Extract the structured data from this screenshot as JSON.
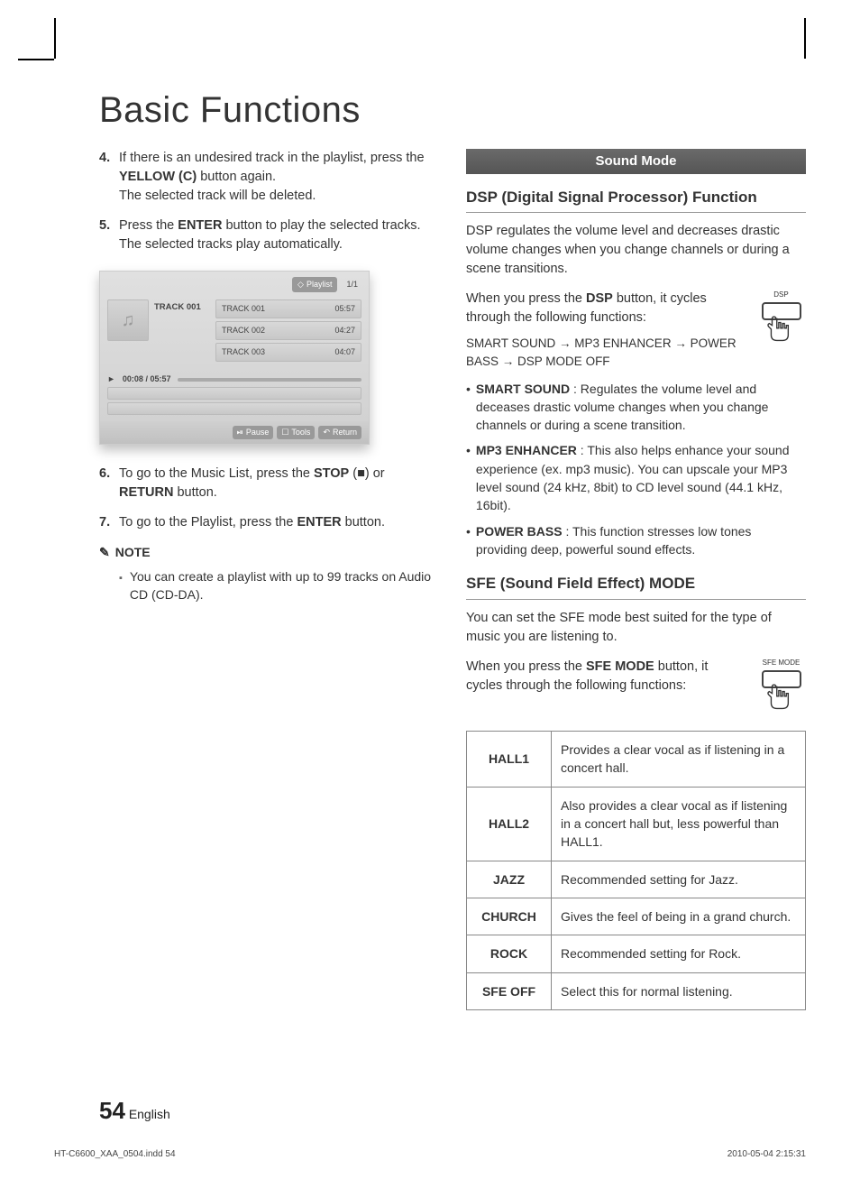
{
  "title": "Basic Functions",
  "left": {
    "steps": {
      "s4_num": "4.",
      "s4_a": "If there is an undesired track in the playlist, press the ",
      "s4_b": "YELLOW (C)",
      "s4_c": " button again.",
      "s4_d": "The selected track will be deleted.",
      "s5_num": "5.",
      "s5_a": "Press the ",
      "s5_b": "ENTER",
      "s5_c": " button to play the selected tracks.",
      "s5_d": "The selected tracks play automatically.",
      "s6_num": "6.",
      "s6_a": "To go to the Music List, press the ",
      "s6_b": "STOP",
      "s6_c": " (■) or ",
      "s6_d": "RETURN",
      "s6_e": " button.",
      "s7_num": "7.",
      "s7_a": "To go to the Playlist, press the ",
      "s7_b": "ENTER",
      "s7_c": " button."
    },
    "mock": {
      "playlist_label": "Playlist",
      "page": "1/1",
      "current": "TRACK 001",
      "rows": [
        {
          "name": "TRACK 001",
          "time": "05:57"
        },
        {
          "name": "TRACK 002",
          "time": "04:27"
        },
        {
          "name": "TRACK 003",
          "time": "04:07"
        }
      ],
      "progress": "00:08 / 05:57",
      "play_glyph": "►",
      "bottom": {
        "pause": "Pause",
        "tools": "Tools",
        "ret": "Return"
      }
    },
    "note_label": "NOTE",
    "note_text": "You can create a playlist with up to 99 tracks on Audio CD (CD-DA)."
  },
  "right": {
    "banner": "Sound Mode",
    "dsp_title": "DSP (Digital Signal Processor) Function",
    "dsp_para": "DSP regulates the volume level and decreases drastic volume changes when you change channels or during a scene transitions.",
    "dsp_press_a": "When you press the ",
    "dsp_press_b": "DSP",
    "dsp_press_c": " button, it cycles through the following functions:",
    "dsp_btn_label": "DSP",
    "chain": {
      "a": "SMART SOUND",
      "b": "MP3 ENHANCER",
      "c": "POWER BASS",
      "d": "DSP MODE OFF"
    },
    "bullets": {
      "b1_k": "SMART SOUND",
      "b1_v": " : Regulates the volume level and deceases drastic volume changes when you change channels or during a scene transition.",
      "b2_k": "MP3 ENHANCER",
      "b2_v": " : This also helps enhance your sound experience (ex. mp3 music). You can upscale your MP3 level sound (24 kHz, 8bit) to CD level sound (44.1 kHz, 16bit).",
      "b3_k": "POWER BASS",
      "b3_v": " : This function stresses low tones providing deep, powerful sound effects."
    },
    "sfe_title": "SFE (Sound Field Effect) MODE",
    "sfe_para": "You can set the SFE mode best suited for the type of music you are listening to.",
    "sfe_press_a": "When you press the ",
    "sfe_press_b": "SFE MODE",
    "sfe_press_c": " button, it cycles through the following functions:",
    "sfe_btn_label": "SFE MODE",
    "table": [
      {
        "k": "HALL1",
        "v": "Provides a clear vocal as if listening in a concert hall."
      },
      {
        "k": "HALL2",
        "v": "Also provides a clear vocal as if listening in a concert hall but, less powerful than HALL1."
      },
      {
        "k": "JAZZ",
        "v": "Recommended setting for Jazz."
      },
      {
        "k": "CHURCH",
        "v": "Gives the feel of being in a grand church."
      },
      {
        "k": "ROCK",
        "v": "Recommended setting for Rock."
      },
      {
        "k": "SFE OFF",
        "v": "Select this for normal listening."
      }
    ]
  },
  "footer": {
    "page": "54",
    "lang": "English"
  },
  "imprint": {
    "file": "HT-C6600_XAA_0504.indd   54",
    "ts": "2010-05-04   2:15:31"
  }
}
